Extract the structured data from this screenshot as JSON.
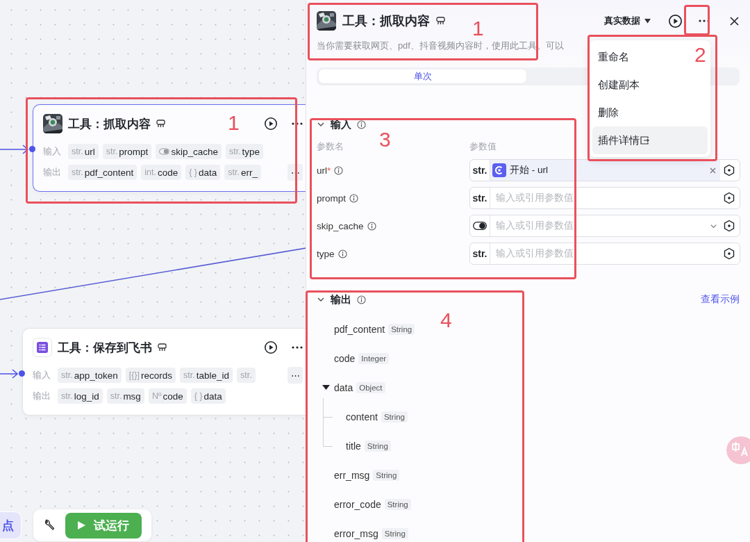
{
  "canvas": {
    "nodes": [
      {
        "title": "工具：抓取内容",
        "selected": true,
        "rows": [
          {
            "label": "输入",
            "params": [
              {
                "kind": "text",
                "prefix": "str.",
                "name": "url"
              },
              {
                "kind": "text",
                "prefix": "str.",
                "name": "prompt"
              },
              {
                "kind": "toggle",
                "name": "skip_cache"
              },
              {
                "kind": "text",
                "prefix": "str.",
                "name": "type"
              }
            ]
          },
          {
            "label": "输出",
            "more": "⋯",
            "params": [
              {
                "kind": "text",
                "prefix": "str.",
                "name": "pdf_content"
              },
              {
                "kind": "text",
                "prefix": "int.",
                "name": "code"
              },
              {
                "kind": "text",
                "prefix": "{ }",
                "name": "data"
              },
              {
                "kind": "text",
                "prefix": "str.",
                "name": "err_"
              }
            ]
          }
        ]
      },
      {
        "title": "工具：保存到飞书",
        "selected": false,
        "rows": [
          {
            "label": "输入",
            "more": "⋯",
            "params": [
              {
                "kind": "text",
                "prefix": "str.",
                "name": "app_token"
              },
              {
                "kind": "text",
                "prefix": "[{}]",
                "name": "records"
              },
              {
                "kind": "text",
                "prefix": "str.",
                "name": "table_id"
              },
              {
                "kind": "text",
                "prefix": "str."
              }
            ]
          },
          {
            "label": "输出",
            "params": [
              {
                "kind": "text",
                "prefix": "str.",
                "name": "log_id"
              },
              {
                "kind": "text",
                "prefix": "str.",
                "name": "msg"
              },
              {
                "kind": "text",
                "prefix": "Nº",
                "name": "code"
              },
              {
                "kind": "text",
                "prefix": "{ }",
                "name": "data"
              }
            ]
          }
        ]
      }
    ],
    "toolbar": {
      "add_label": "点",
      "run_label": "试运行"
    }
  },
  "panel": {
    "title": "工具：抓取内容",
    "description": "当你需要获取网页、pdf、抖音视频内容时，使用此工具。可以",
    "data_mode": "真实数据",
    "tabs": [
      {
        "label": "单次",
        "selected": true
      }
    ],
    "menu": [
      {
        "label": "重命名",
        "highlighted": false
      },
      {
        "label": "创建副本",
        "highlighted": false
      },
      {
        "label": "删除",
        "highlighted": false
      },
      {
        "label": "插件详情",
        "highlighted": true,
        "external": true
      }
    ],
    "inputs": {
      "title": "输入",
      "expanded": true,
      "name_header": "参数名",
      "value_header": "参数值",
      "params": [
        {
          "name": "url",
          "marker": "*",
          "kind": "ref",
          "prefix": "str.",
          "ref": "开始 - url"
        },
        {
          "name": "prompt",
          "kind": "text",
          "prefix": "str.",
          "placeholder": "输入或引用参数值"
        },
        {
          "name": "skip_cache",
          "kind": "toggle",
          "placeholder": "输入或引用参数值"
        },
        {
          "name": "type",
          "kind": "text",
          "prefix": "str.",
          "placeholder": "输入或引用参数值"
        }
      ]
    },
    "outputs": {
      "title": "输出",
      "expanded": true,
      "example_link": "查看示例",
      "items": [
        {
          "name": "pdf_content",
          "type": "String"
        },
        {
          "name": "code",
          "type": "Integer"
        },
        {
          "name": "data",
          "type": "Object",
          "expanded": true,
          "children": [
            {
              "name": "content",
              "type": "String"
            },
            {
              "name": "title",
              "type": "String"
            }
          ]
        },
        {
          "name": "err_msg",
          "type": "String"
        },
        {
          "name": "error_code",
          "type": "String"
        },
        {
          "name": "error_msg",
          "type": "String"
        }
      ]
    }
  },
  "annotations": [
    {
      "label": "1"
    },
    {
      "label": "1"
    },
    {
      "label": "2"
    },
    {
      "label": "3"
    },
    {
      "label": "4"
    }
  ]
}
